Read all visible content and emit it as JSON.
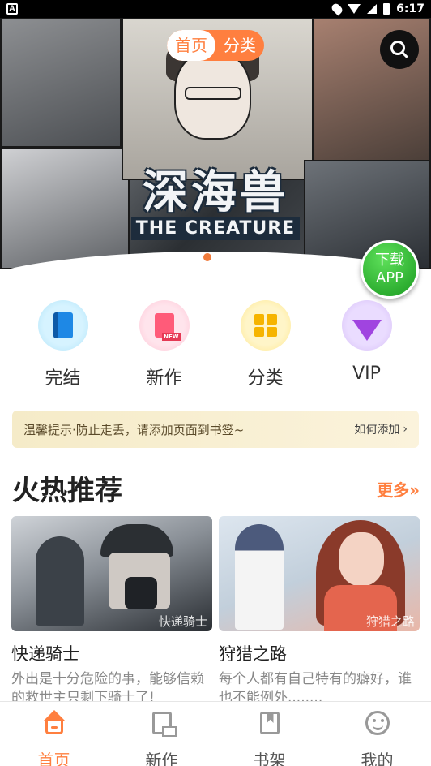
{
  "status_bar": {
    "time": "6:17"
  },
  "banner": {
    "tabs": [
      {
        "label": "首页",
        "active": true
      },
      {
        "label": "分类",
        "active": false
      }
    ],
    "title_cn": "深海兽",
    "title_en": "THE CREATURE",
    "download": {
      "line1": "下载",
      "line2": "APP"
    }
  },
  "quick_nav": [
    {
      "label": "完结",
      "icon": "book-icon"
    },
    {
      "label": "新作",
      "icon": "new-doc-icon"
    },
    {
      "label": "分类",
      "icon": "category-search-icon"
    },
    {
      "label": "VIP",
      "icon": "diamond-icon"
    }
  ],
  "notice": {
    "text": "温馨提示·防止走丢，请添加页面到书签~",
    "action": "如何添加"
  },
  "section": {
    "title": "火热推荐",
    "more": "更多»",
    "cards": [
      {
        "title": "快递骑士",
        "watermark": "快递骑士",
        "desc": "外出是十分危险的事，能够信赖的救世主只剩下骑士了!"
      },
      {
        "title": "狩猎之路",
        "watermark": "狩猎之路",
        "desc": "每个人都有自己特有的癖好，谁也不能例外........"
      }
    ]
  },
  "bottom_nav": [
    {
      "label": "首页",
      "active": true
    },
    {
      "label": "新作",
      "active": false
    },
    {
      "label": "书架",
      "active": false
    },
    {
      "label": "我的",
      "active": false
    }
  ],
  "colors": {
    "accent": "#ff7f3f",
    "download_green": "#1a9a20"
  }
}
